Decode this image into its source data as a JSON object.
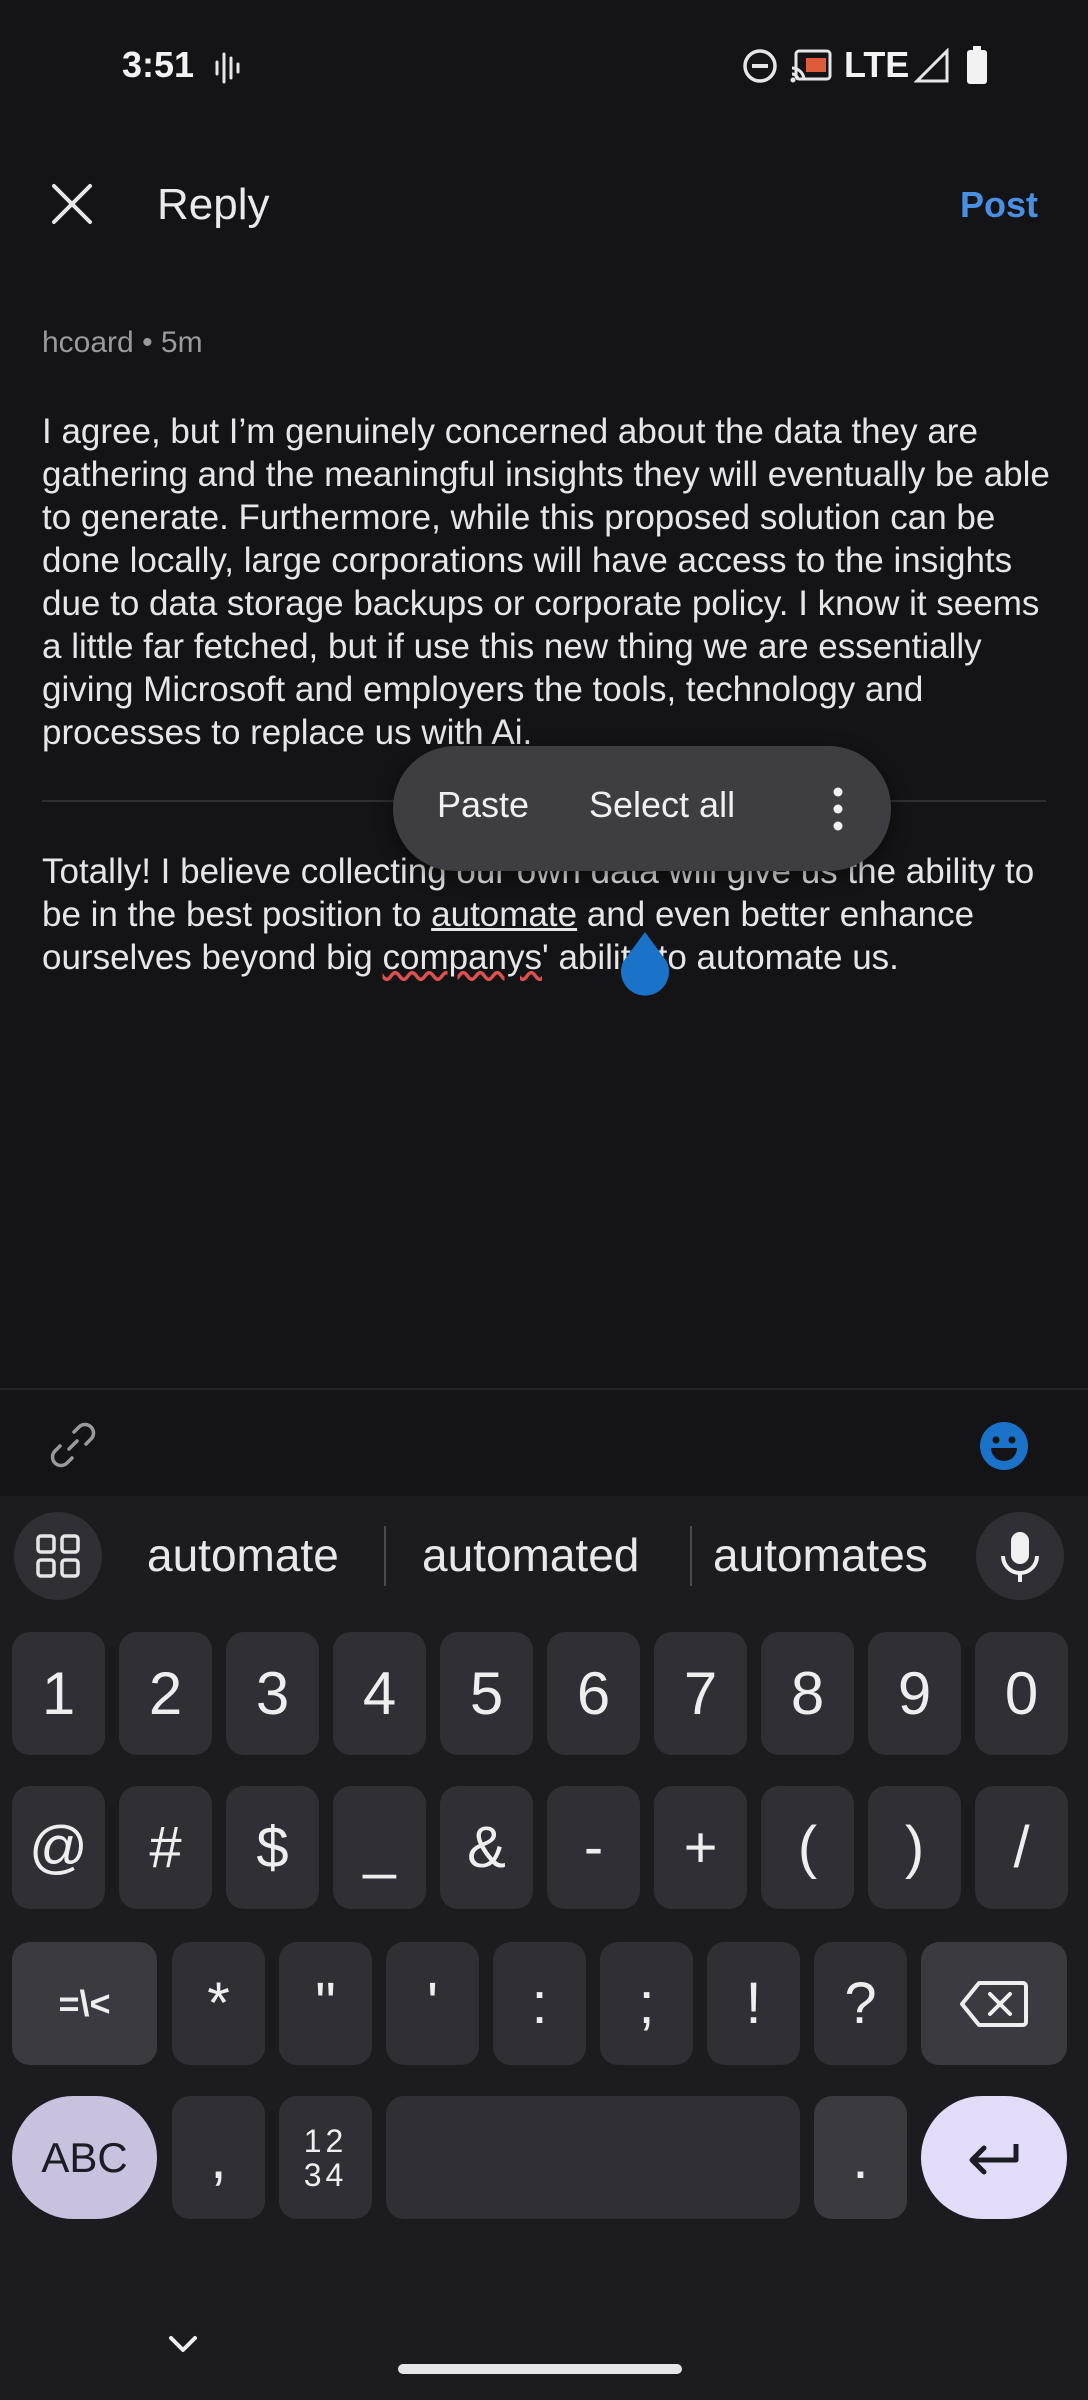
{
  "status": {
    "time": "3:51",
    "network": "LTE"
  },
  "app_bar": {
    "title": "Reply",
    "post_label": "Post"
  },
  "original_post": {
    "author": "hcoard",
    "age": "5m",
    "body": "I agree, but I’m genuinely concerned about the data they are gathering and the meaningful insights they will eventually be able to generate. Furthermore, while this proposed solution can be done locally, large corporations will have access to the insights due to data storage backups or corporate policy. I know it seems a little far fetched, but if use this new thing we are essentially giving Microsoft and employers the tools, technology and processes to replace us with Ai."
  },
  "reply": {
    "part1": "Totally! I believe collecting our own data will give us the ability to be in the best position to ",
    "underlined_word": "automate",
    "part2": " and even better enhance ourselves beyond big ",
    "misspelled_word": "companys",
    "part3": "' ability to automate us."
  },
  "selection_popup": {
    "paste": "Paste",
    "select_all": "Select all"
  },
  "keyboard": {
    "suggestions": [
      "automate",
      "automated",
      "automates"
    ],
    "row1": [
      "1",
      "2",
      "3",
      "4",
      "5",
      "6",
      "7",
      "8",
      "9",
      "0"
    ],
    "row2": [
      "@",
      "#",
      "$",
      "_",
      "&",
      "-",
      "+",
      "(",
      ")",
      "/"
    ],
    "row3": [
      "*",
      "\"",
      "'",
      ":",
      ";",
      "!",
      "?"
    ],
    "row3_left": "=\\<",
    "abc_label": "ABC",
    "comma": ",",
    "numpad_top": "12",
    "numpad_bottom": "34",
    "period": "."
  },
  "colors": {
    "accent": "#4a90e2",
    "handle": "#1a73c9",
    "enter_bg": "#e3dcf8",
    "abc_bg": "#c9c2de"
  }
}
